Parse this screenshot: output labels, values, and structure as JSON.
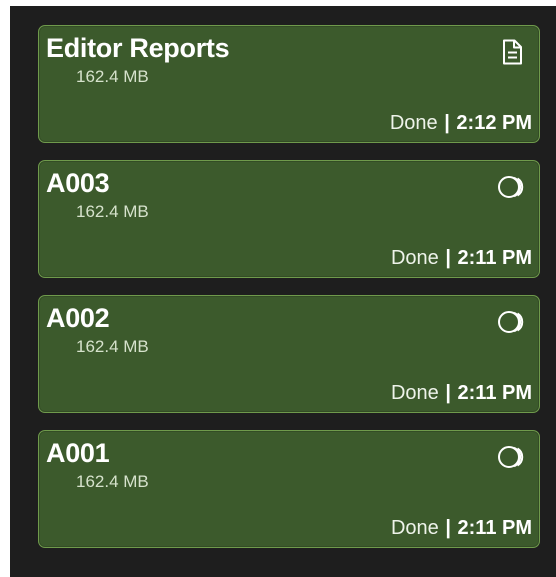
{
  "items": [
    {
      "title": "Editor Reports",
      "size": "162.4 MB",
      "status": "Done",
      "separator": "|",
      "time": "2:12 PM",
      "icon": "document-icon"
    },
    {
      "title": "A003",
      "size": "162.4 MB",
      "status": "Done",
      "separator": "|",
      "time": "2:11 PM",
      "icon": "clips-icon"
    },
    {
      "title": "A002",
      "size": "162.4 MB",
      "status": "Done",
      "separator": "|",
      "time": "2:11 PM",
      "icon": "clips-icon"
    },
    {
      "title": "A001",
      "size": "162.4 MB",
      "status": "Done",
      "separator": "|",
      "time": "2:11 PM",
      "icon": "clips-icon"
    }
  ]
}
